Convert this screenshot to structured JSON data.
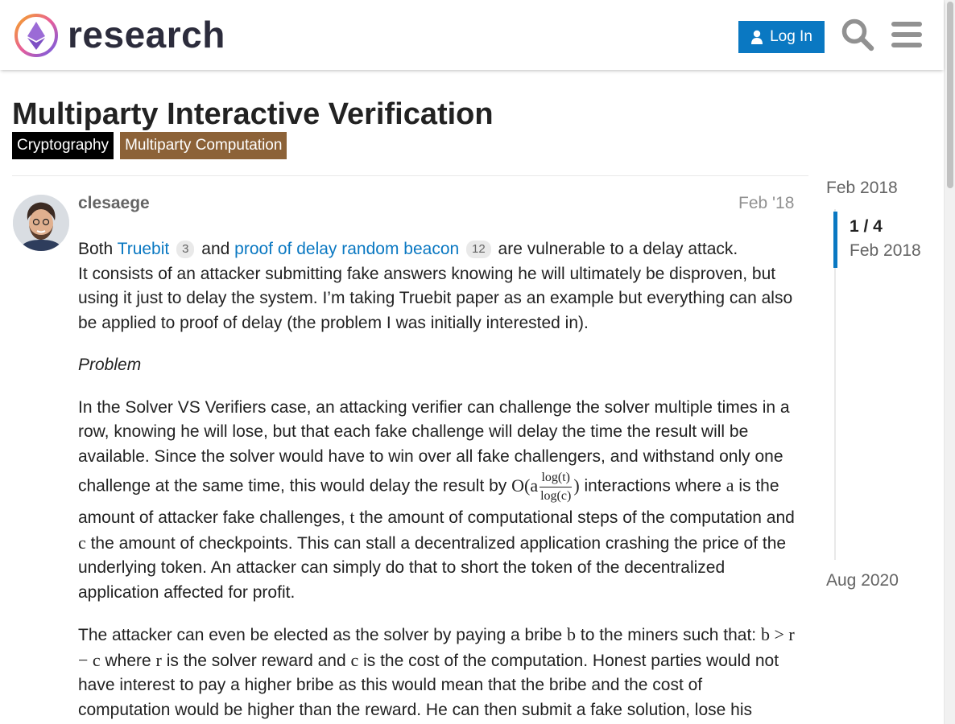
{
  "header": {
    "site_name": "research",
    "login_label": "Log In",
    "accent": "#0a78c2"
  },
  "topic": {
    "title": "Multiparty Interactive Verification",
    "categories": [
      {
        "label": "Cryptography",
        "color": "#000000"
      },
      {
        "label": "Multiparty Computation",
        "color": "#8c6238"
      }
    ]
  },
  "post": {
    "username": "clesaege",
    "date": "Feb '18",
    "p1": {
      "t1": "Both ",
      "link1": "Truebit",
      "count1": "3",
      "t2": " and ",
      "link2": "proof of delay random beacon",
      "count2": "12",
      "t3": " are vulnerable to a delay attack.",
      "t4": "It consists of an attacker submitting fake answers knowing he will ultimately be disproven, but using it just to delay the system. I’m taking Truebit paper as an example but everything can also be applied to proof of delay (the problem I was initially interested in)."
    },
    "p2": "Problem",
    "p3": {
      "t1": "In the Solver VS Verifiers case, an attacking verifier can challenge the solver multiple times in a row, knowing he will lose, but that each fake challenge will delay the time the result will be available. Since the solver would have to win over all fake challengers, and withstand only one challenge at the same time, this would delay the result by ",
      "math_pre": "O(a",
      "frac_num": "log(t)",
      "frac_den": "log(c)",
      "math_post": ")",
      "t2": " interactions where ",
      "var_a": "a",
      "t3": " is the amount of attacker fake challenges, ",
      "var_t": "t",
      "t4": " the amount of computational steps of the computation and ",
      "var_c": "c",
      "t5": " the amount of checkpoints. This can stall a decentralized application crashing the price of the underlying token. An attacker can simply do that to short the token of the decentralized application affected for profit."
    },
    "p4": {
      "t1": "The attacker can even be elected as the solver by paying a bribe ",
      "var_b": "b",
      "t2": " to the miners such that: ",
      "ineq": "b > r − c",
      "t3": " where ",
      "var_r": "r",
      "t4": " is the solver reward and ",
      "var_c": "c",
      "t5": " is the cost of the computation. Honest parties would not have interest to pay a higher bribe as this would mean that the bribe and the cost of computation would be higher than the reward. He can then submit a fake solution, lose his"
    }
  },
  "timeline": {
    "start": "Feb 2018",
    "progress": "1 / 4",
    "progress_date": "Feb 2018",
    "end": "Aug 2020"
  }
}
